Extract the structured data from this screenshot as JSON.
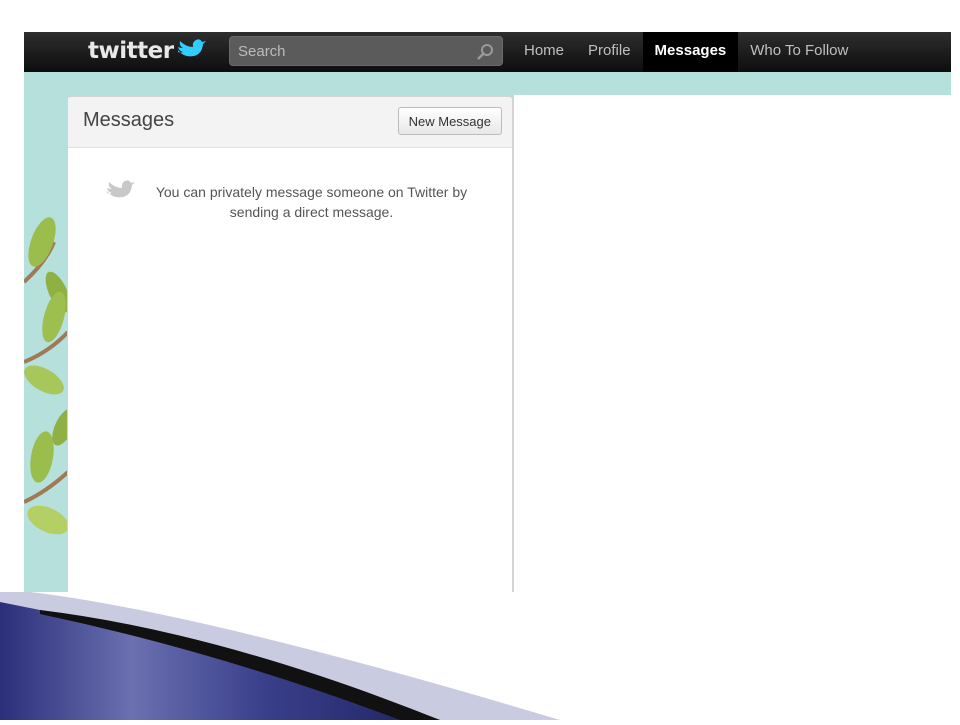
{
  "logo": {
    "text": "twitter"
  },
  "search": {
    "placeholder": "Search"
  },
  "nav": {
    "items": [
      {
        "label": "Home",
        "active": false
      },
      {
        "label": "Profile",
        "active": false
      },
      {
        "label": "Messages",
        "active": true
      },
      {
        "label": "Who To Follow",
        "active": false
      }
    ]
  },
  "panel": {
    "title": "Messages",
    "new_message_label": "New Message",
    "empty_line1": "You can privately message someone on Twitter by",
    "empty_line2": "sending a direct message."
  },
  "colors": {
    "topbar": "#1a1a1a",
    "background": "#b5e0dc",
    "twitter_blue": "#33ccff",
    "leaf": "#9bbd4b"
  },
  "icons": [
    "twitter-bird-icon",
    "search-icon",
    "bird-icon"
  ]
}
